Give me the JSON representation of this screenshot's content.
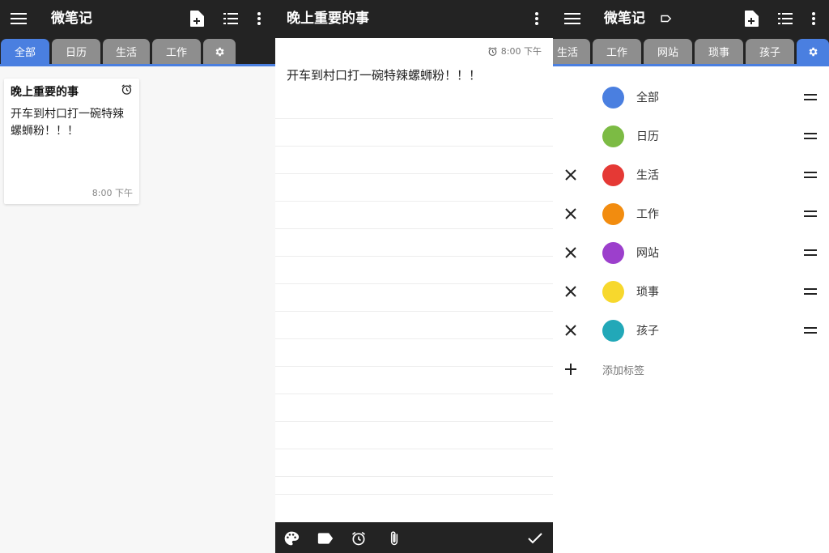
{
  "left_panel": {
    "app_title": "微笔记",
    "tabs": [
      {
        "label": "全部",
        "active": true
      },
      {
        "label": "日历",
        "active": false
      },
      {
        "label": "生活",
        "active": false
      },
      {
        "label": "工作",
        "active": false
      }
    ],
    "settings_tab_icon": "gear-icon",
    "note_card": {
      "title": "晚上重要的事",
      "body": "开车到村口打一碗特辣螺蛳粉！！！",
      "time": "8:00 下午"
    }
  },
  "editor": {
    "title": "晚上重要的事",
    "alarm_time": "8:00 下午",
    "body": "开车到村口打一碗特辣螺蛳粉！！！",
    "bottom_icons": [
      "palette-icon",
      "label-icon",
      "alarm-icon",
      "attach-icon",
      "check-icon"
    ]
  },
  "right_panel": {
    "app_title": "微笔记",
    "tabs": [
      {
        "label": "生活",
        "active": false
      },
      {
        "label": "工作",
        "active": false
      },
      {
        "label": "网站",
        "active": false
      },
      {
        "label": "琐事",
        "active": false
      },
      {
        "label": "孩子",
        "active": false
      }
    ],
    "labels": [
      {
        "name": "全部",
        "color": "#4a7fe0",
        "removable": false
      },
      {
        "name": "日历",
        "color": "#7cbb44",
        "removable": false
      },
      {
        "name": "生活",
        "color": "#e53935",
        "removable": true
      },
      {
        "name": "工作",
        "color": "#f28c0f",
        "removable": true
      },
      {
        "name": "网站",
        "color": "#9c3fcc",
        "removable": true
      },
      {
        "name": "琐事",
        "color": "#f7d82d",
        "removable": true
      },
      {
        "name": "孩子",
        "color": "#22a8b8",
        "removable": true
      }
    ],
    "add_label_text": "添加标签"
  },
  "colors": {
    "appbar": "#232323",
    "accent": "#4a7fe0",
    "tab_inactive": "#8e8e8e"
  }
}
